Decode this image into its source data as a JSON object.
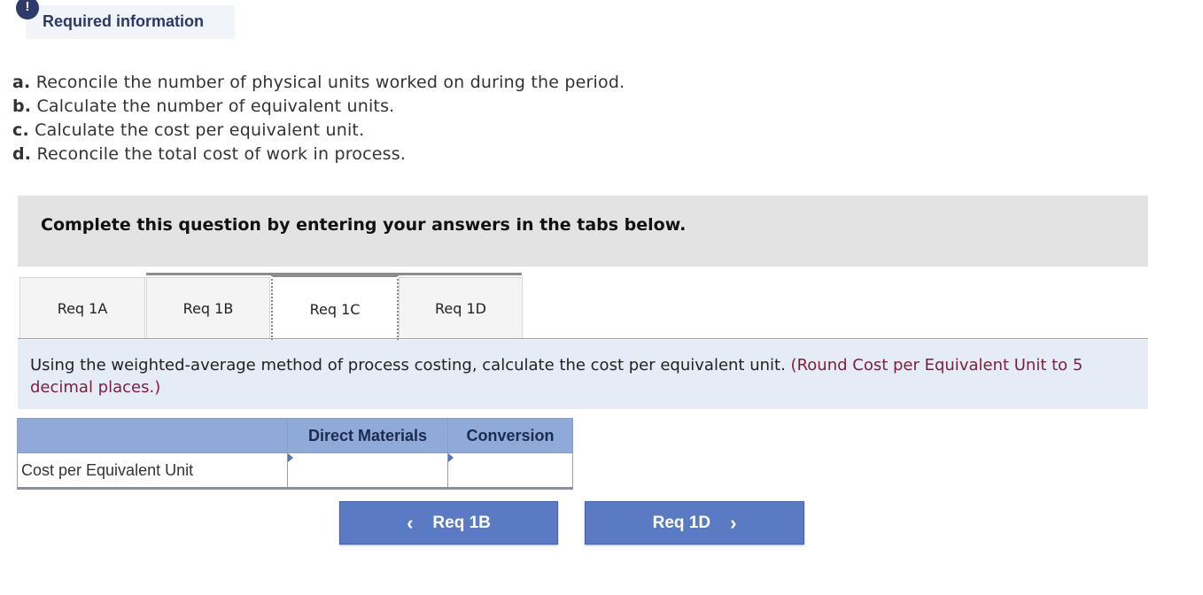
{
  "header": {
    "alert_icon": "!",
    "title": "Required information"
  },
  "requirements": [
    {
      "letter": "a.",
      "text": "Reconcile the number of physical units worked on during the period."
    },
    {
      "letter": "b.",
      "text": "Calculate the number of equivalent units."
    },
    {
      "letter": "c.",
      "text": "Calculate the cost per equivalent unit."
    },
    {
      "letter": "d.",
      "text": "Reconcile the total cost of work in process."
    }
  ],
  "instruction": "Complete this question by entering your answers in the tabs below.",
  "tabs": [
    {
      "label": "Req 1A",
      "active": false
    },
    {
      "label": "Req 1B",
      "active": false
    },
    {
      "label": "Req 1C",
      "active": true
    },
    {
      "label": "Req 1D",
      "active": false
    }
  ],
  "question": {
    "text": "Using the weighted-average method of process costing, calculate the cost per equivalent unit.",
    "hint": "(Round Cost per Equivalent Unit to 5 decimal places.)"
  },
  "table": {
    "headers": [
      "",
      "Direct Materials",
      "Conversion"
    ],
    "rows": [
      {
        "label": "Cost per Equivalent Unit",
        "direct_materials": "",
        "conversion": ""
      }
    ]
  },
  "navigation": {
    "prev_label": "Req 1B",
    "prev_icon": "‹",
    "next_label": "Req 1D",
    "next_icon": "›"
  }
}
